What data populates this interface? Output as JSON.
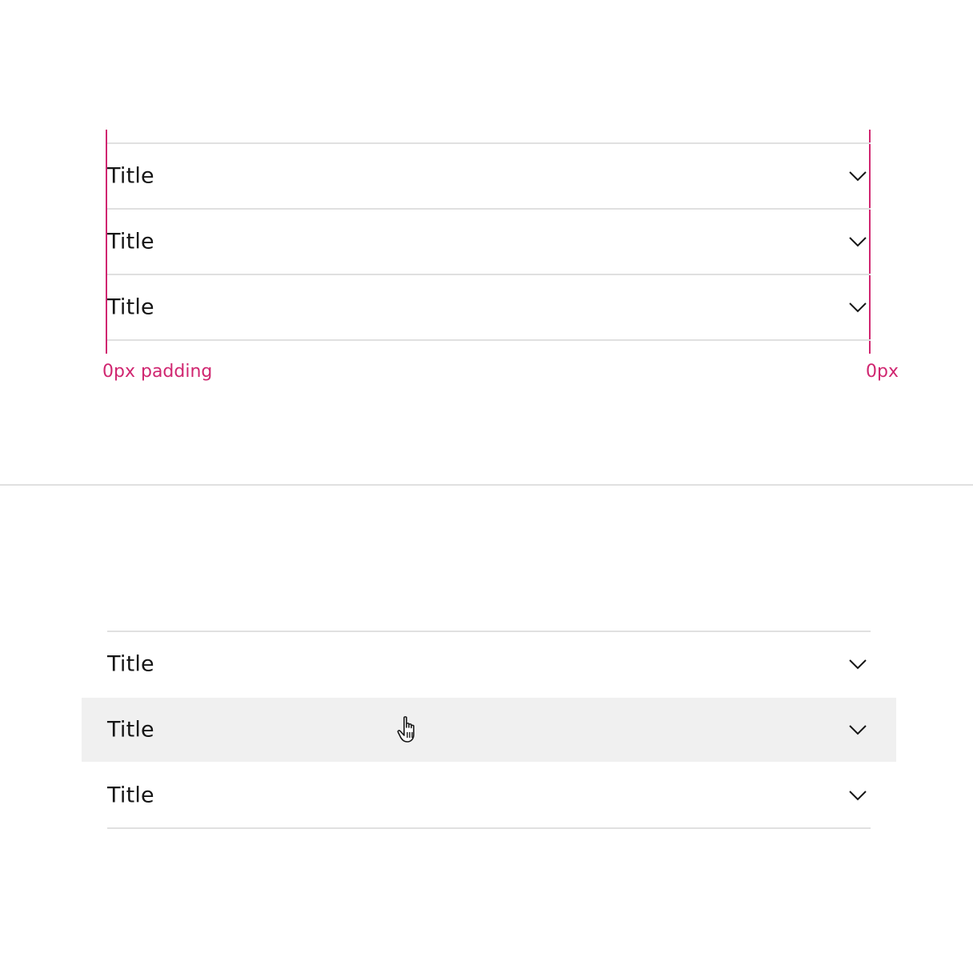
{
  "top_specimen": {
    "items": [
      {
        "title": "Title",
        "icon": "chevron-down-icon"
      },
      {
        "title": "Title",
        "icon": "chevron-down-icon"
      },
      {
        "title": "Title",
        "icon": "chevron-down-icon"
      }
    ],
    "left_annotation": "0px padding",
    "right_annotation": "0px",
    "annotation_color": "#d02670"
  },
  "bottom_specimen": {
    "items": [
      {
        "title": "Title",
        "icon": "chevron-down-icon",
        "state": "default"
      },
      {
        "title": "Title",
        "icon": "chevron-down-icon",
        "state": "hover"
      },
      {
        "title": "Title",
        "icon": "chevron-down-icon",
        "state": "default"
      }
    ],
    "hover_color": "#f0f0f0",
    "cursor": "pointer-hand-icon"
  },
  "colors": {
    "divider": "#e0e0e0",
    "text": "#161616",
    "background": "#ffffff"
  }
}
